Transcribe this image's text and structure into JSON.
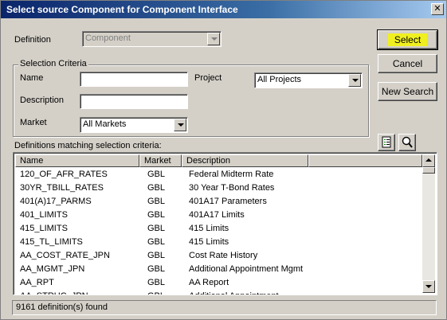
{
  "window": {
    "title": "Select source Component for Component Interface",
    "close_glyph": "✕"
  },
  "definition": {
    "label": "Definition",
    "value": "Component"
  },
  "buttons": {
    "select": "Select",
    "cancel": "Cancel",
    "new_search": "New Search"
  },
  "criteria": {
    "group_title": "Selection Criteria",
    "name_label": "Name",
    "name_value": "",
    "description_label": "Description",
    "description_value": "",
    "market_label": "Market",
    "market_value": "All Markets",
    "project_label": "Project",
    "project_value": "All Projects"
  },
  "list": {
    "caption": "Definitions matching selection criteria:",
    "columns": [
      "Name",
      "Market",
      "Description"
    ],
    "rows": [
      [
        "120_OF_AFR_RATES",
        "GBL",
        "Federal Midterm Rate"
      ],
      [
        "30YR_TBILL_RATES",
        "GBL",
        "30 Year T-Bond Rates"
      ],
      [
        "401(A)17_PARMS",
        "GBL",
        "401A17 Parameters"
      ],
      [
        "401_LIMITS",
        "GBL",
        "401A17 Limits"
      ],
      [
        "415_LIMITS",
        "GBL",
        "415 Limits"
      ],
      [
        "415_TL_LIMITS",
        "GBL",
        "415 Limits"
      ],
      [
        "AA_COST_RATE_JPN",
        "GBL",
        "Cost Rate History"
      ],
      [
        "AA_MGMT_JPN",
        "GBL",
        "Additional Appointment Mgmt"
      ],
      [
        "AA_RPT",
        "GBL",
        "AA Report"
      ],
      [
        "AA_STRUC_JPN",
        "GBL",
        "Additional Appointment"
      ]
    ]
  },
  "status": {
    "text": "9161 definition(s) found"
  },
  "icons": [
    "close-icon",
    "dropdown-arrow-icon",
    "list-view-icon",
    "search-icon",
    "scroll-up-icon",
    "scroll-down-icon"
  ],
  "colors": {
    "titlebar_start": "#0a246a",
    "titlebar_end": "#a6caf0",
    "face": "#d4d0c8",
    "highlight": "#f0f020"
  }
}
